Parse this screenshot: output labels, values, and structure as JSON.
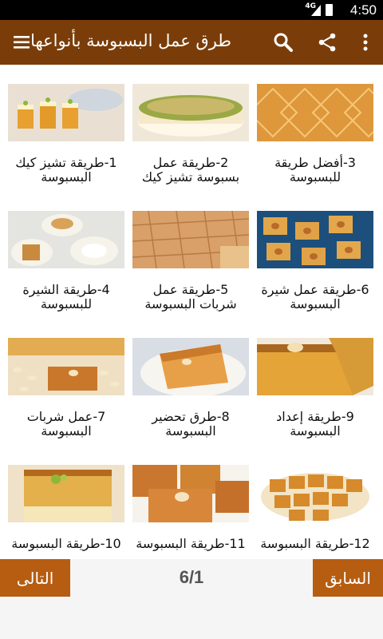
{
  "status": {
    "network": "4G",
    "time": "4:50"
  },
  "app": {
    "title": "طرق عمل البسبوسة بأنواعها"
  },
  "items": [
    {
      "caption": "3-أفضل طريقة للبسبوسة"
    },
    {
      "caption": "2-طريقة عمل بسبوسة تشيز كيك"
    },
    {
      "caption": "1-طريقة تشيز كيك البسبوسة"
    },
    {
      "caption": "6-طريقة عمل شيرة البسبوسة"
    },
    {
      "caption": "5-طريقة عمل شربات البسبوسة"
    },
    {
      "caption": "4-طريقة الشيرة للبسبوسة"
    },
    {
      "caption": "9-طريقة إعداد البسبوسة"
    },
    {
      "caption": "8-طرق تحضير البسبوسة"
    },
    {
      "caption": "7-عمل شربات البسبوسة"
    },
    {
      "caption": "12-طريقة البسبوسة"
    },
    {
      "caption": "11-طريقة البسبوسة"
    },
    {
      "caption": "10-طريقة البسبوسة"
    }
  ],
  "pagination": {
    "next_label": "التالى",
    "prev_label": "السابق",
    "page_indicator": "6/1"
  }
}
